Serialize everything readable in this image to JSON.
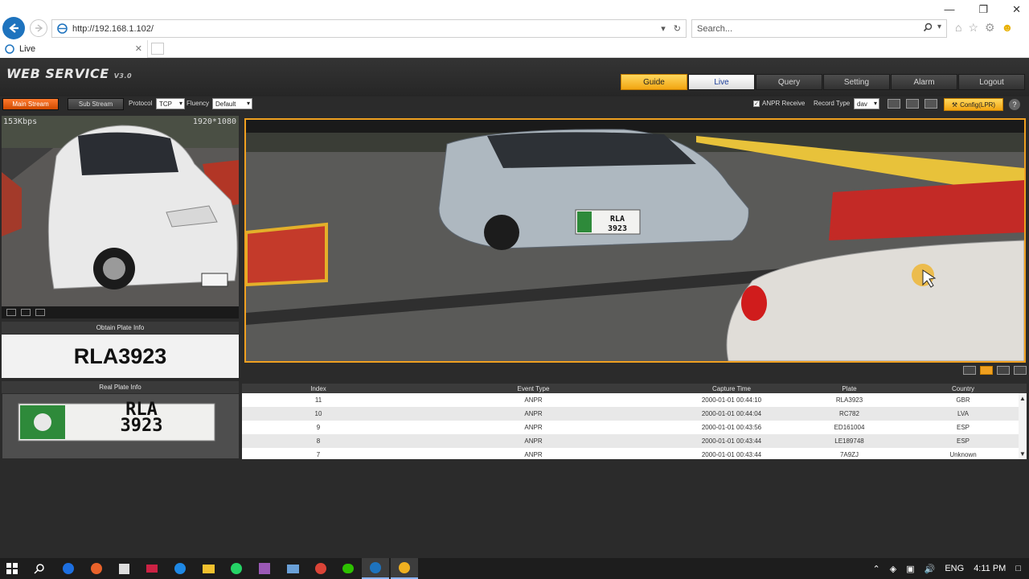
{
  "browser": {
    "url": "http://192.168.1.102/",
    "search_placeholder": "Search...",
    "tab_title": "Live"
  },
  "app": {
    "logo": "WEB SERVICE",
    "version": "V3.0",
    "nav": [
      "Guide",
      "Live",
      "Query",
      "Setting",
      "Alarm",
      "Logout"
    ],
    "nav_active": "Guide",
    "nav_current": "Live"
  },
  "toolbar": {
    "main_stream": "Main Stream",
    "sub_stream": "Sub Stream",
    "protocol_label": "Protocol",
    "protocol_value": "TCP",
    "fluency_label": "Fluency",
    "fluency_value": "Default",
    "anpr_receive": "ANPR Receive",
    "anpr_checked": true,
    "record_type_label": "Record Type",
    "record_type_value": "dav",
    "config_label": "Config(LPR)"
  },
  "thumbnail": {
    "bitrate": "153Kbps",
    "resolution": "1920*1080"
  },
  "plate": {
    "obtain_title": "Obtain Plate Info",
    "plate_number": "RLA3923",
    "real_title": "Real Plate Info",
    "plate_line1": "RLA",
    "plate_line2": "3923"
  },
  "video": {
    "plate_line1": "RLA",
    "plate_line2": "3923"
  },
  "table": {
    "headers": [
      "Index",
      "Event Type",
      "Capture Time",
      "Plate",
      "Country"
    ],
    "rows": [
      [
        "11",
        "ANPR",
        "2000-01-01 00:44:10",
        "RLA3923",
        "GBR"
      ],
      [
        "10",
        "ANPR",
        "2000-01-01 00:44:04",
        "RC782",
        "LVA"
      ],
      [
        "9",
        "ANPR",
        "2000-01-01 00:43:56",
        "ED161004",
        "ESP"
      ],
      [
        "8",
        "ANPR",
        "2000-01-01 00:43:44",
        "LE189748",
        "ESP"
      ],
      [
        "7",
        "ANPR",
        "2000-01-01 00:43:44",
        "7A9ZJ",
        "Unknown"
      ]
    ]
  },
  "taskbar": {
    "language": "ENG",
    "time": "4:11 PM"
  },
  "colors": {
    "accent": "#f0a020",
    "main_stream": "#e0601a",
    "app_bg": "#2b2b2b",
    "ie_blue": "#1e73be"
  },
  "icons": [
    "back-arrow-icon",
    "forward-arrow-icon",
    "refresh-icon",
    "search-icon",
    "home-icon",
    "star-icon",
    "gear-icon",
    "smiley-icon",
    "windows-start-icon",
    "wrench-icon",
    "help-icon"
  ]
}
